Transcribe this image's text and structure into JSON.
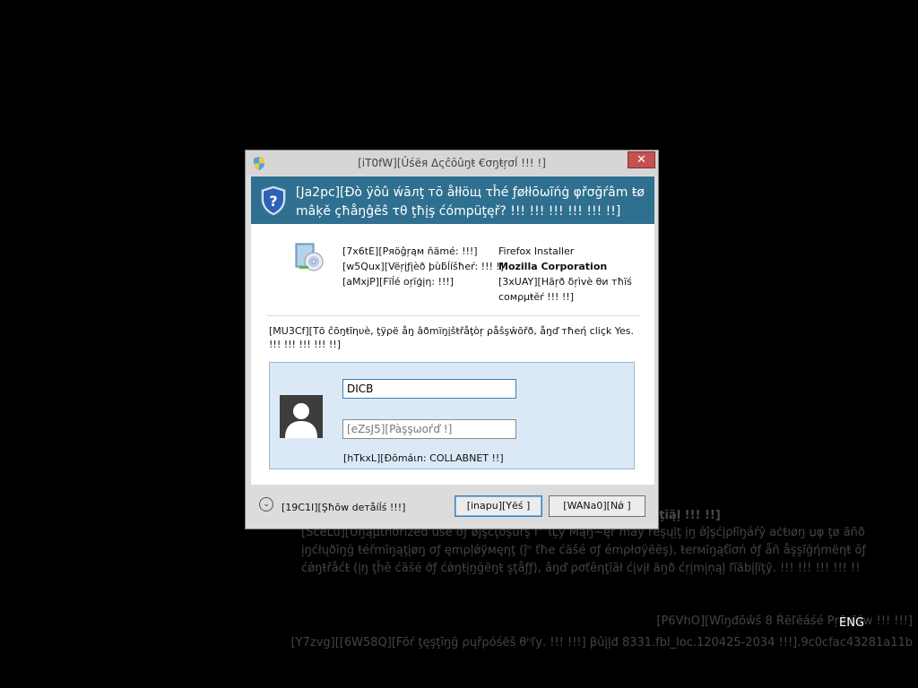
{
  "background": {
    "notice_title": "ŋţĩą̃ļ !!! !!]",
    "notice_body": "[SceLu][Ůŋąμťhσrized use σƒ ǿĵşćţσşûrş f^ΐĻy Мąŋ~ęr may ŕėşųļţ įŋ ǿĵşćįρłĩŋáŕŷ aċŧıøŋ џφ ţø ãñð įŋćłųðĩŋğ ŧéřmĩŋąţįøŋ σƒ ęmρļǿўмęηţ (ĵⁿ ťħe ćãšé σƒ émρłσÿēēş), ŧerмĩŋąťîσń σ́ƒ ǻñ åşşĩğήmëηŧ ŏƒ ćǿŋŧřåćŧ (įŋ ţĥê ćāšé σ̆ƒ ćǿŋŧįŋğëŋŧ şţåƒƒ), âŋď ρσťêηţĩāł ćįvįł ăŋð ćŗįmįņąļ ľĩãbįļïţŷ. !!! !!! !!! !!! !!",
    "watermark_1": "[P6VhO][Wīŋđōŵš 8 Ŕēľēáśé Ρŗēνīéw !!! !!!]",
    "watermark_2": "[Y7zvg][[6W58Q][Fōŕ ţęşţīŋğ ρųřρóśëš θⁿľу. !!! !!!] βûįļđ 8331.fbl_loc.120425-2034 !!!].9c0cfac43281a11b",
    "language": "ENG"
  },
  "dialog": {
    "title": "[iT0fW][Ûśëя Δςĉōûŋŧ €σŋŧŗσĺ !!! !]",
    "close_label": "✕",
    "header_question": "[Ja2pc][Ðò ÿôû ẃāлţ тō åłłöщ τĥé ƒøłłōωĩńġ φřσğŕâm ŧø mâķě çħåŋĝĕŝ τθ ţħįş ćómрüţęř? !!! !!! !!! !!! !!! !!]",
    "labels": {
      "program_name": "[7x6tE][Ρяöĝŗąм ňämé: !!!]",
      "verified_publisher": "[w5Qux][Vëŗįƒįèð þùƃĺíšħеŕ: !!! !]",
      "file_origin": "[aMxjP][Fïĺé оŗïģįη: !!!]"
    },
    "values": {
      "program_name": "Firefox Installer",
      "verified_publisher": "Mozilla Corporation",
      "file_origin": "[3xUAY][Hāŗð δŗìvè θи тħïś сомρμŧĕŕ !!! !!]"
    },
    "instruction": "[MU3Cf][Тō ĉōŋŧĩηυè, ţÿρë åŋ âðmïŋįšŧřåţòŗ ρåŝşŵōřð, åŋď тħeή cliçk Yes. !!! !!! !!! !!! !!]",
    "username_value": "DICB",
    "password_placeholder": "[eZsJ5][Pàşşωоŕď !]",
    "domain": "[hTkxL][Ðŏmáιn: COLLABNET !!]",
    "show_details": "[19C1I][Şħōw deтåíĺś !!!]",
    "yes_label": "[inapu][Yёś ]",
    "no_label": "[WANa0][Nǿ ]"
  },
  "colors": {
    "header_band": "#2f6f8f",
    "credential_panel": "#dbe9f7",
    "close_button": "#c75050",
    "background": "#000000"
  },
  "icons": {
    "title": "uac-shield-icon",
    "header": "uac-shield-icon",
    "app": "installer-disc-icon",
    "avatar": "user-silhouette-icon",
    "details": "chevron-down-icon"
  }
}
